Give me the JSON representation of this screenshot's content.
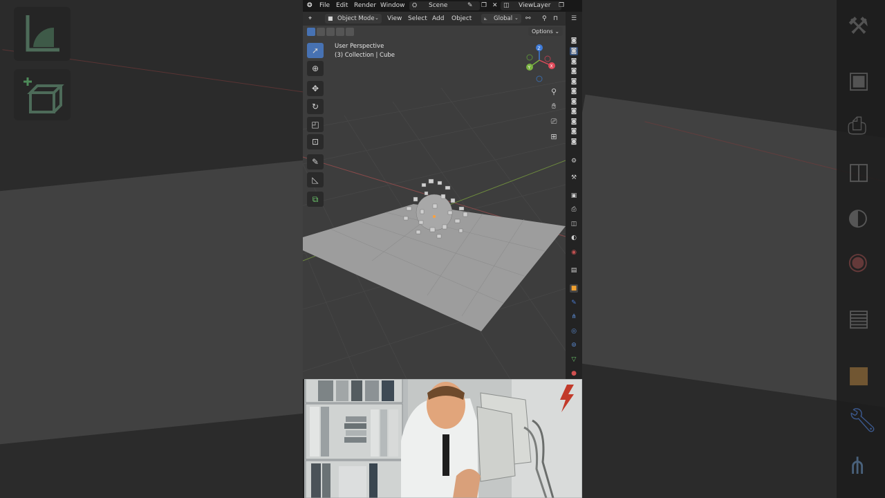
{
  "menu": {
    "file": "File",
    "edit": "Edit",
    "render": "Render",
    "window": "Window",
    "scene": "Scene",
    "view_layer": "ViewLayer"
  },
  "header": {
    "mode": "Object Mode",
    "view": "View",
    "select": "Select",
    "add": "Add",
    "object": "Object",
    "orientation": "Global",
    "options": "Options"
  },
  "viewport": {
    "perspective": "User Perspective",
    "collection": "(3) Collection | Cube"
  },
  "gizmo": {
    "x_label": "X",
    "y_label": "Y",
    "z_label": "Z"
  },
  "colors": {
    "accent": "#4772b3",
    "x_axis": "#e04a5a",
    "y_axis": "#7ab241",
    "z_axis": "#3f7bd8"
  }
}
